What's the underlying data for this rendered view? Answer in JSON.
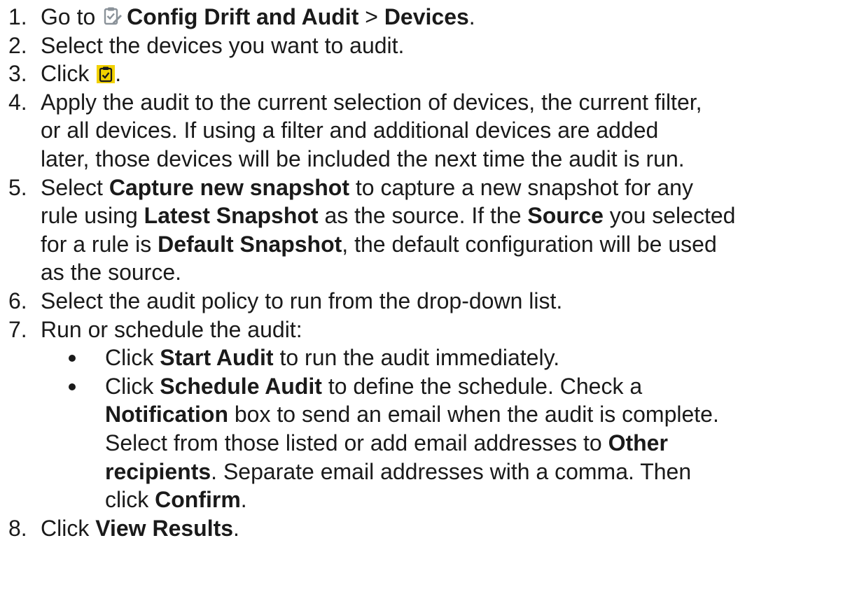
{
  "steps": [
    {
      "num": "1.",
      "t1": "Go to ",
      "icon": "config-drift-clipboard-icon",
      "b1": "Config Drift and Audit",
      "t2": " > ",
      "b2": "Devices",
      "t3": "."
    },
    {
      "num": "2.",
      "t1": "Select the devices you want to audit."
    },
    {
      "num": "3.",
      "t1": "Click ",
      "icon": "audit-clipboard-check-icon",
      "t2": "."
    },
    {
      "num": "4.",
      "l1": "Apply the audit to the current selection of devices, the current filter,",
      "l2": "or all devices. If using a filter and additional devices are added",
      "l3": "later, those devices will be included the next time the audit is run."
    },
    {
      "num": "5.",
      "t1": "Select ",
      "b1": "Capture new snapshot",
      "t2": " to capture a new snapshot for any",
      "t3": "rule using ",
      "b2": "Latest Snapshot",
      "t4": " as the source. If the ",
      "b3": "Source",
      "t5": " you selected",
      "t6": "for a rule is ",
      "b4": "Default Snapshot",
      "t7": ", the default configuration will be used",
      "t8": "as the source."
    },
    {
      "num": "6.",
      "t1": "Select the audit policy to run from the drop-down list."
    },
    {
      "num": "7.",
      "t1": "Run or schedule the audit:",
      "bullets": [
        {
          "t1": "Click ",
          "b1": "Start Audit",
          "t2": " to run the audit immediately."
        },
        {
          "t1": "Click ",
          "b1": "Schedule Audit",
          "t2": " to define the schedule. Check a",
          "b2": "Notification",
          "t3": " box to send an email when the audit is complete.",
          "t4": "Select from those listed or add email addresses to ",
          "b3": "Other",
          "b4": "recipients",
          "t5": ". Separate email addresses with a comma. Then",
          "t6": "click ",
          "b5": "Confirm",
          "t7": "."
        }
      ]
    },
    {
      "num": "8.",
      "t1": "Click ",
      "b1": "View Results",
      "t2": "."
    }
  ],
  "colors": {
    "text": "#1a1a1a",
    "audit_icon_bg": "#f2d100",
    "drift_icon": "#8a9299"
  }
}
